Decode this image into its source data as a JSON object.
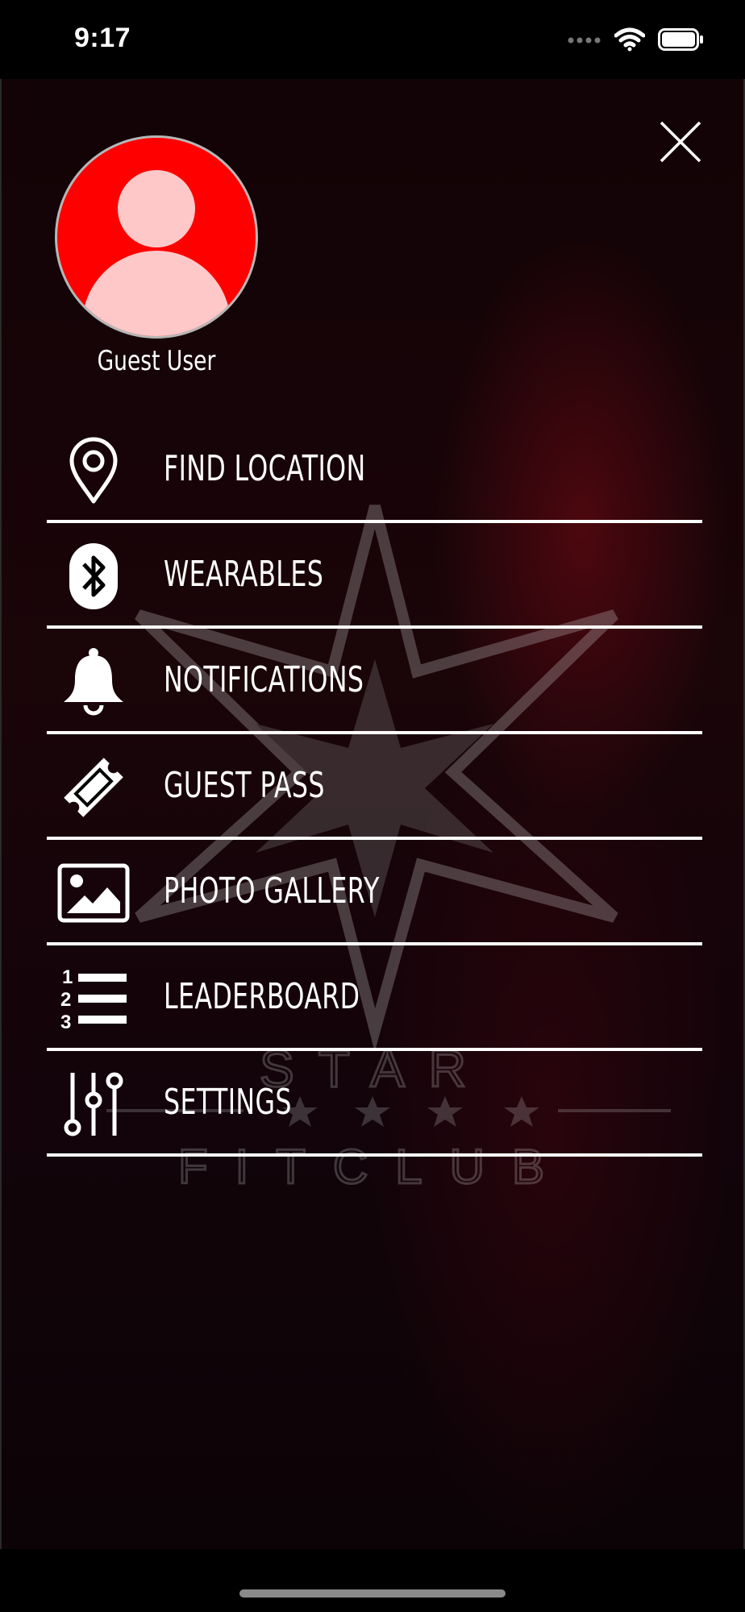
{
  "status_bar": {
    "time": "9:17"
  },
  "profile": {
    "name": "Guest User"
  },
  "menu": {
    "items": [
      {
        "label": "FIND LOCATION",
        "icon": "map-pin-icon"
      },
      {
        "label": "WEARABLES",
        "icon": "bluetooth-icon"
      },
      {
        "label": "NOTIFICATIONS",
        "icon": "bell-icon"
      },
      {
        "label": "GUEST PASS",
        "icon": "ticket-icon"
      },
      {
        "label": "PHOTO GALLERY",
        "icon": "image-icon"
      },
      {
        "label": "LEADERBOARD",
        "icon": "ranked-list-icon"
      },
      {
        "label": "SETTINGS",
        "icon": "sliders-icon"
      }
    ]
  },
  "watermark": {
    "line1": "STAR",
    "line2": "FITCLUB"
  },
  "colors": {
    "avatar_bg": "#ff0000",
    "avatar_figure": "#ffc8c8",
    "divider": "#ffffff"
  }
}
